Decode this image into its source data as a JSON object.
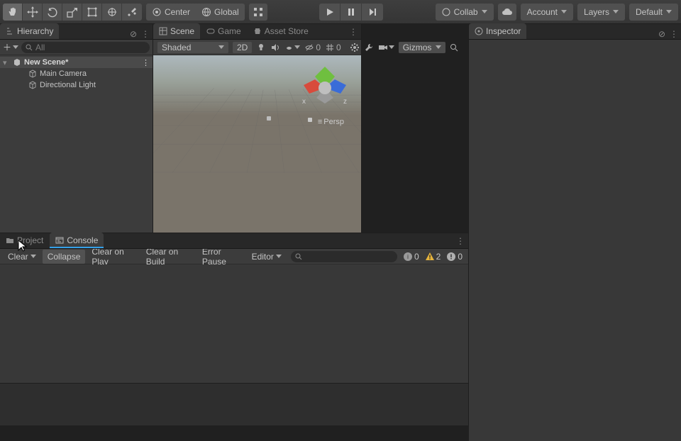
{
  "toolbar": {
    "handle_center": "Center",
    "handle_global": "Global",
    "collab": "Collab",
    "account": "Account",
    "layers": "Layers",
    "layout": "Default"
  },
  "hierarchy": {
    "title": "Hierarchy",
    "search_placeholder": "All",
    "scene": "New Scene*",
    "items": [
      "Main Camera",
      "Directional Light"
    ]
  },
  "scene": {
    "tabs": {
      "scene": "Scene",
      "game": "Game",
      "asset_store": "Asset Store"
    },
    "shading": "Shaded",
    "mode_2d": "2D",
    "fx_count": "0",
    "grid_count": "0",
    "gizmos": "Gizmos",
    "persp": "Persp",
    "axes": {
      "x": "x",
      "z": "z"
    }
  },
  "project_console": {
    "tabs": {
      "project": "Project",
      "console": "Console"
    },
    "buttons": {
      "clear": "Clear",
      "collapse": "Collapse",
      "clear_play": "Clear on Play",
      "clear_build": "Clear on Build",
      "error_pause": "Error Pause",
      "editor": "Editor"
    },
    "counts": {
      "info": "0",
      "warn": "2",
      "error": "0"
    }
  },
  "inspector": {
    "title": "Inspector"
  }
}
